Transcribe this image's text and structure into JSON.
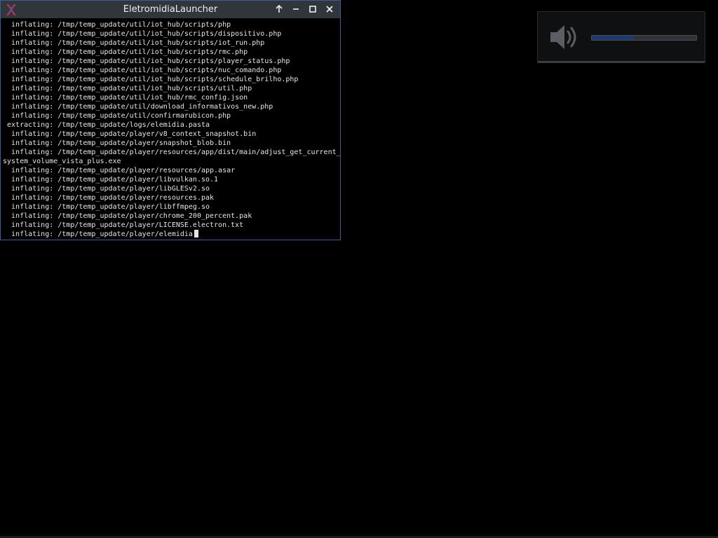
{
  "window": {
    "title": "EletromidiaLauncher",
    "controls": [
      {
        "name": "keep-above-button",
        "icon": "arrow-up-icon"
      },
      {
        "name": "minimize-button",
        "icon": "minimize-icon"
      },
      {
        "name": "maximize-button",
        "icon": "maximize-icon"
      },
      {
        "name": "close-button",
        "icon": "close-icon"
      }
    ],
    "app_icon": "x-logo-icon"
  },
  "terminal": {
    "lines": [
      "  inflating: /tmp/temp_update/util/iot_hub/scripts/php",
      "  inflating: /tmp/temp_update/util/iot_hub/scripts/dispositivo.php",
      "  inflating: /tmp/temp_update/util/iot_hub/scripts/iot_run.php",
      "  inflating: /tmp/temp_update/util/iot_hub/scripts/rmc.php",
      "  inflating: /tmp/temp_update/util/iot_hub/scripts/player_status.php",
      "  inflating: /tmp/temp_update/util/iot_hub/scripts/nuc_comando.php",
      "  inflating: /tmp/temp_update/util/iot_hub/scripts/schedule_brilho.php",
      "  inflating: /tmp/temp_update/util/iot_hub/scripts/util.php",
      "  inflating: /tmp/temp_update/util/iot_hub/rmc_config.json",
      "  inflating: /tmp/temp_update/util/download_informativos_new.php",
      "  inflating: /tmp/temp_update/util/confirmarubicon.php",
      " extracting: /tmp/temp_update/logs/elemidia.pasta",
      "  inflating: /tmp/temp_update/player/v8_context_snapshot.bin",
      "  inflating: /tmp/temp_update/player/snapshot_blob.bin",
      "  inflating: /tmp/temp_update/player/resources/app/dist/main/adjust_get_current_",
      "system_volume_vista_plus.exe",
      "  inflating: /tmp/temp_update/player/resources/app.asar",
      "  inflating: /tmp/temp_update/player/libvulkan.so.1",
      "  inflating: /tmp/temp_update/player/libGLESv2.so",
      "  inflating: /tmp/temp_update/player/resources.pak",
      "  inflating: /tmp/temp_update/player/libffmpeg.so",
      "  inflating: /tmp/temp_update/player/chrome_200_percent.pak",
      "  inflating: /tmp/temp_update/player/LICENSE.electron.txt",
      "  inflating: /tmp/temp_update/player/elemidia"
    ]
  },
  "volume_osd": {
    "icon": "speaker-muted-icon",
    "level_fraction": 0.4
  },
  "colors": {
    "titlebar_bg": "#31363b",
    "window_border": "#3f5a9e",
    "terminal_fg": "#e6e6e6",
    "osd_fill": "#1d3a6b"
  }
}
